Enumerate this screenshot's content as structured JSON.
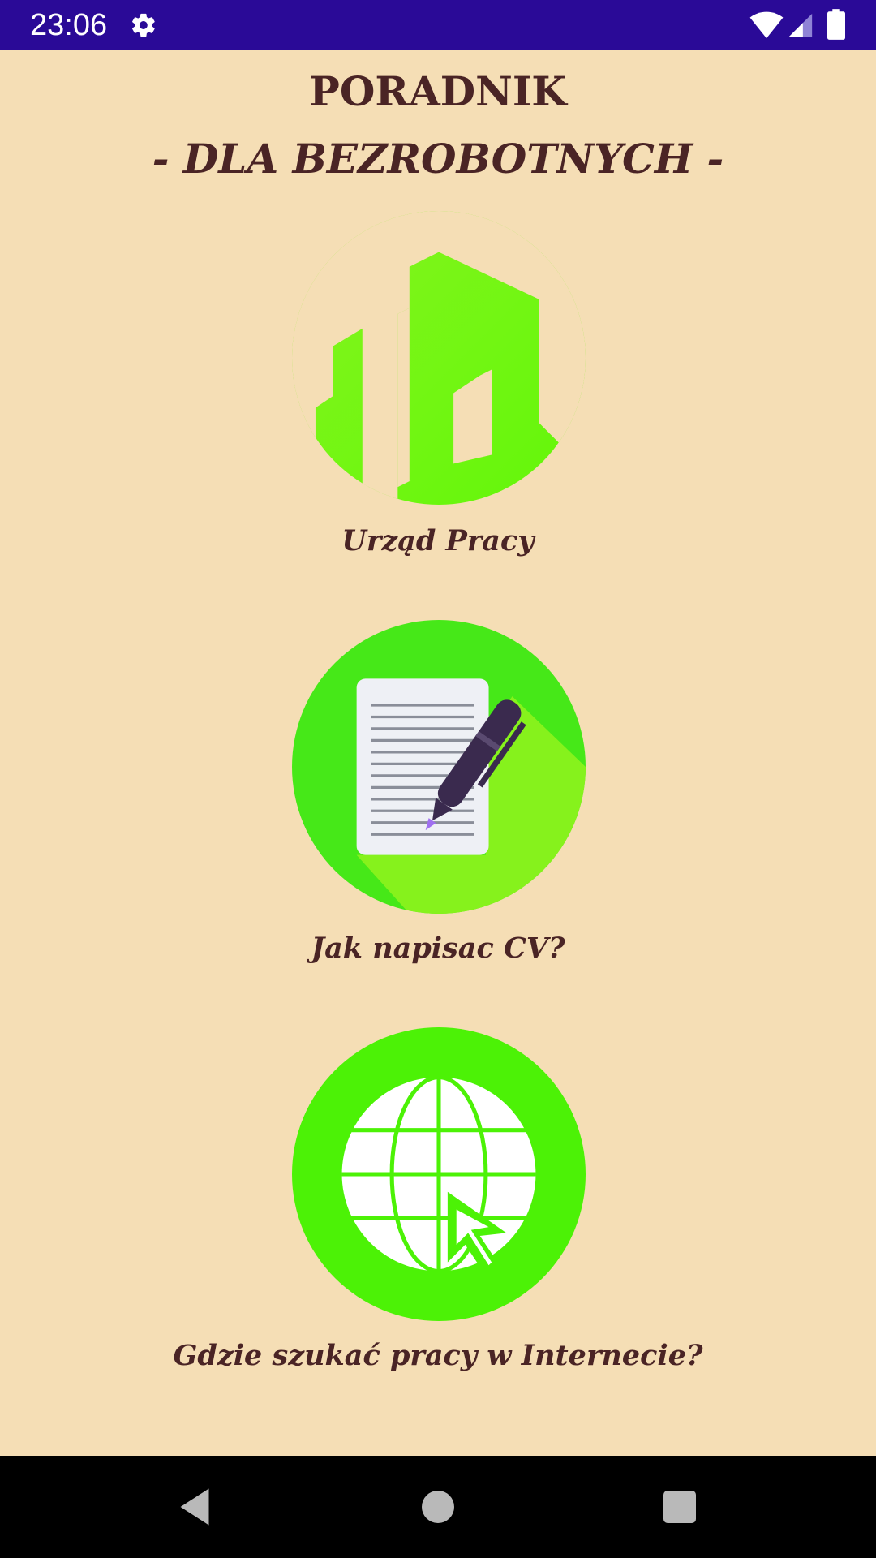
{
  "status_bar": {
    "time": "23:06",
    "icons": [
      "settings-gear-icon",
      "wifi-icon",
      "cell-signal-icon",
      "battery-icon"
    ],
    "background": "#2A0A97"
  },
  "header": {
    "title": "PORADNIK",
    "subtitle": "- DLA BEZROBOTNYCH -"
  },
  "menu": [
    {
      "label": "Urząd Pracy",
      "icon": "buildings-icon",
      "icon_color": "#6CF70E"
    },
    {
      "label": "Jak napisac CV?",
      "icon": "document-pen-icon",
      "icon_color": "#46E818"
    },
    {
      "label": "Gdzie szukać pracy w Internecie?",
      "icon": "globe-cursor-icon",
      "icon_color": "#4CF206"
    }
  ],
  "nav_bar": {
    "buttons": [
      "back-icon",
      "home-icon",
      "recents-icon"
    ]
  },
  "colors": {
    "background": "#F5DEB5",
    "text": "#4A2425",
    "accent_green": "#4CF206"
  }
}
